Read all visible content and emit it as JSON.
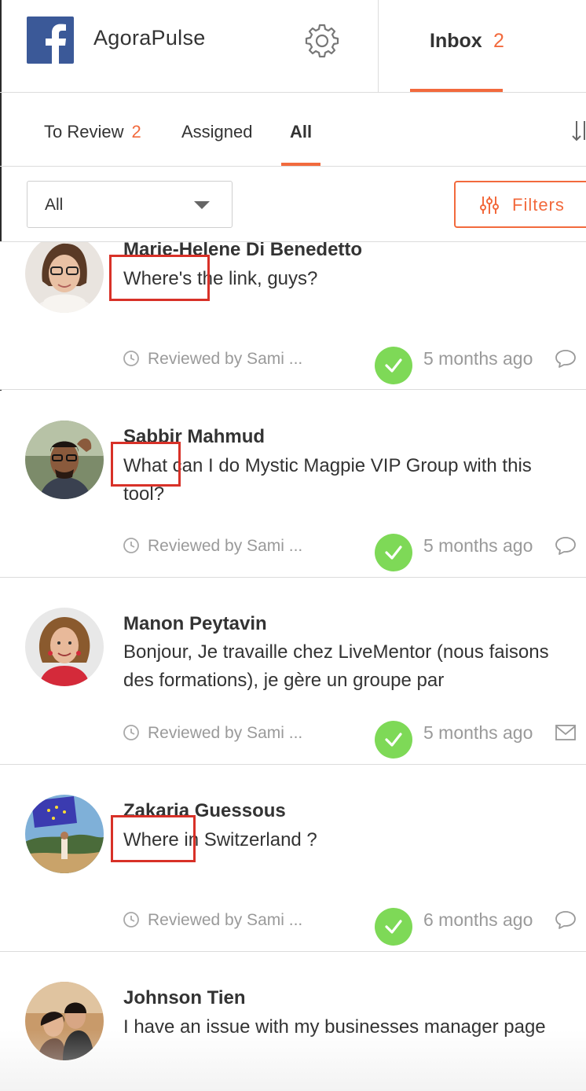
{
  "header": {
    "account_name": "AgoraPulse",
    "inbox_label": "Inbox",
    "inbox_count": "2"
  },
  "subtabs": [
    {
      "label": "To Review",
      "badge": "2"
    },
    {
      "label": "Assigned"
    },
    {
      "label": "All"
    }
  ],
  "filter": {
    "select_value": "All",
    "filters_label": "Filters"
  },
  "items": [
    {
      "author": "Marie-Helene Di Benedetto",
      "message": "Where's the link, guys?",
      "reviewed": "Reviewed by Sami ...",
      "time": "5 months ago",
      "channel_icon": "comment-icon"
    },
    {
      "author": "Sabbir Mahmud",
      "message": "What can I do Mystic Magpie VIP Group with this tool?",
      "reviewed": "Reviewed by Sami ...",
      "time": "5 months ago",
      "channel_icon": "comment-icon"
    },
    {
      "author": "Manon Peytavin",
      "message": "Bonjour, Je travaille chez LiveMentor (nous faisons des formations), je gère un groupe par",
      "reviewed": "Reviewed by Sami ...",
      "time": "5 months ago",
      "channel_icon": "envelope-icon"
    },
    {
      "author": "Zakaria Guessous",
      "message": "Where in Switzerland ?",
      "reviewed": "Reviewed by Sami ...",
      "time": "6 months ago",
      "channel_icon": "comment-icon"
    },
    {
      "author": "Johnson Tien",
      "message": "I have an issue with my businesses manager page"
    }
  ],
  "colors": {
    "accent": "#f26a3d",
    "facebook": "#3b5998",
    "check_green": "#7ed957",
    "highlight_red": "#d83128"
  }
}
